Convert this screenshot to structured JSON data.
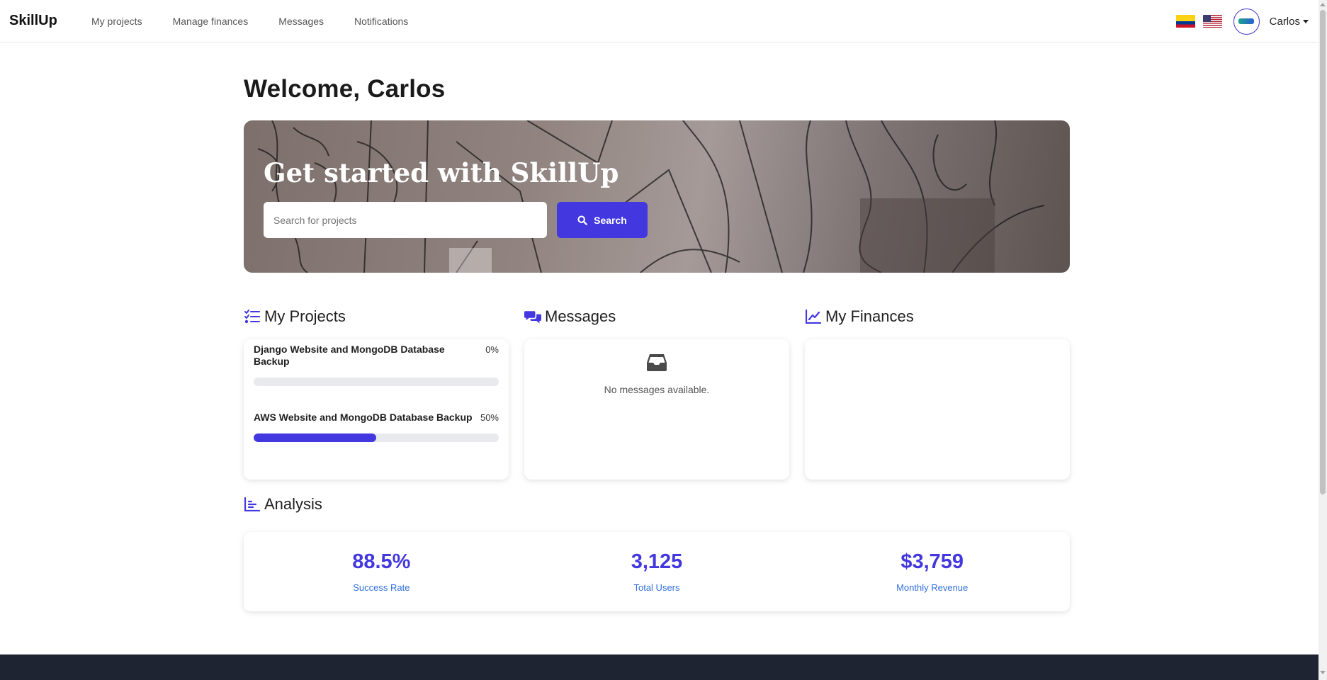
{
  "navbar": {
    "brand": "SkillUp",
    "links": [
      "My projects",
      "Manage finances",
      "Messages",
      "Notifications"
    ],
    "user_name": "Carlos"
  },
  "welcome": "Welcome, Carlos",
  "hero": {
    "title": "Get started with SkillUp",
    "search_placeholder": "Search for projects",
    "search_button": "Search"
  },
  "projects": {
    "title": "My Projects",
    "items": [
      {
        "name": "Django Website and MongoDB Database Backup",
        "progress_label": "0%",
        "progress": 0
      },
      {
        "name": "AWS Website and MongoDB Database Backup",
        "progress_label": "50%",
        "progress": 50
      }
    ]
  },
  "messages": {
    "title": "Messages",
    "empty_text": "No messages available."
  },
  "finances": {
    "title": "My Finances"
  },
  "analysis": {
    "title": "Analysis",
    "stats": [
      {
        "value": "88.5%",
        "label": "Success Rate"
      },
      {
        "value": "3,125",
        "label": "Total Users"
      },
      {
        "value": "$3,759",
        "label": "Monthly Revenue"
      }
    ]
  },
  "colors": {
    "accent": "#4338e0",
    "stat_label": "#2f6fde",
    "footer": "#1f2433"
  },
  "icons": {
    "projects": "list-check-icon",
    "messages": "comments-icon",
    "finances": "line-chart-icon",
    "analysis": "bar-chart-icon",
    "empty_messages": "inbox-icon",
    "search": "search-icon"
  }
}
